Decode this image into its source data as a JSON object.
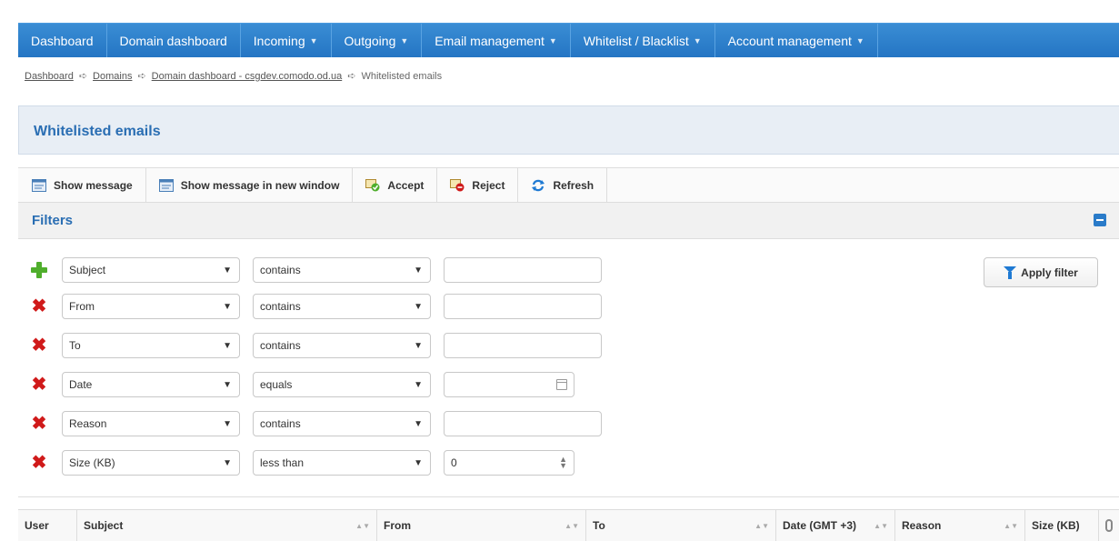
{
  "nav": {
    "items": [
      {
        "label": "Dashboard",
        "dropdown": false
      },
      {
        "label": "Domain dashboard",
        "dropdown": false
      },
      {
        "label": "Incoming",
        "dropdown": true
      },
      {
        "label": "Outgoing",
        "dropdown": true
      },
      {
        "label": "Email management",
        "dropdown": true
      },
      {
        "label": "Whitelist / Blacklist",
        "dropdown": true
      },
      {
        "label": "Account management",
        "dropdown": true
      }
    ]
  },
  "breadcrumb": {
    "items": [
      "Dashboard",
      "Domains",
      "Domain dashboard - csgdev.comodo.od.ua"
    ],
    "current": "Whitelisted emails"
  },
  "page": {
    "title": "Whitelisted emails"
  },
  "toolbar": {
    "show_message": "Show message",
    "show_message_new_window": "Show message in new window",
    "accept": "Accept",
    "reject": "Reject",
    "refresh": "Refresh"
  },
  "filters": {
    "title": "Filters",
    "apply_label": "Apply filter",
    "rows": [
      {
        "field": "Subject",
        "operator": "contains",
        "value": "",
        "input": "text"
      },
      {
        "field": "From",
        "operator": "contains",
        "value": "",
        "input": "text"
      },
      {
        "field": "To",
        "operator": "contains",
        "value": "",
        "input": "text"
      },
      {
        "field": "Date",
        "operator": "equals",
        "value": "",
        "input": "date"
      },
      {
        "field": "Reason",
        "operator": "contains",
        "value": "",
        "input": "text"
      },
      {
        "field": "Size (KB)",
        "operator": "less than",
        "value": "0",
        "input": "number"
      }
    ]
  },
  "table": {
    "columns": [
      "User",
      "Subject",
      "From",
      "To",
      "Date (GMT +3)",
      "Reason",
      "Size (KB)"
    ]
  },
  "colors": {
    "nav_bg": "#2475c4",
    "accent": "#2a6eb3",
    "remove": "#d01a1a",
    "add": "#4fae2c"
  }
}
